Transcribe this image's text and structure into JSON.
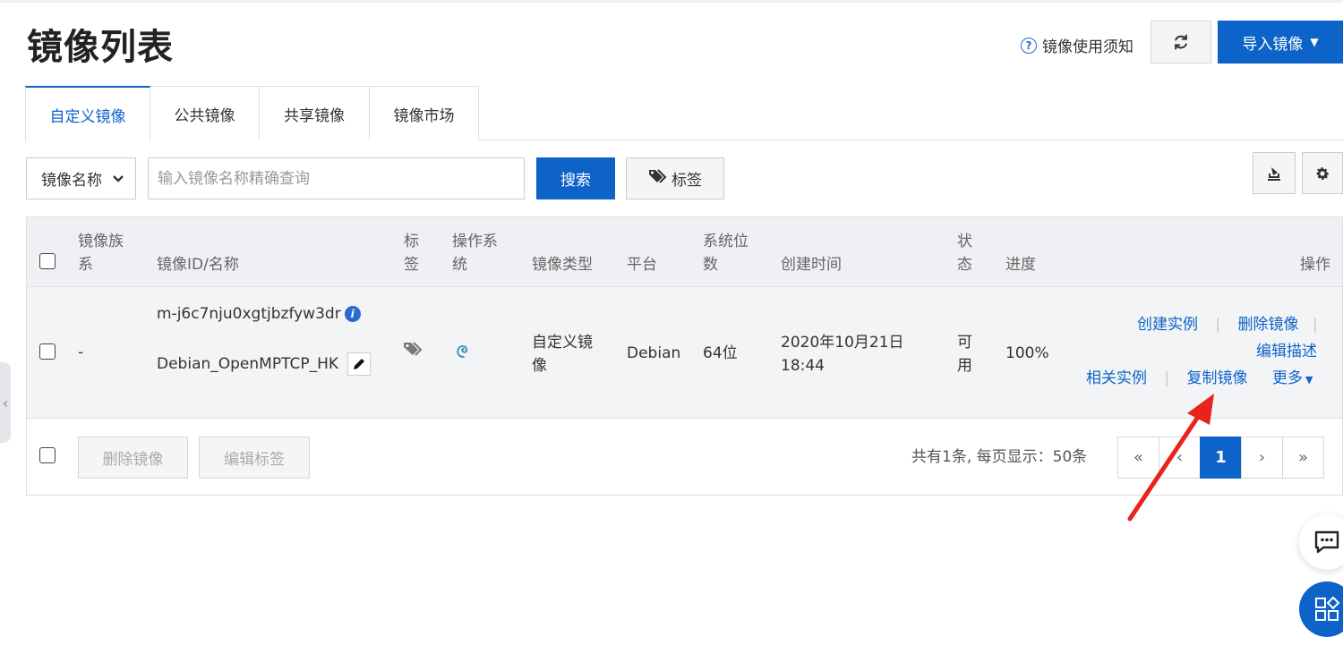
{
  "page": {
    "title": "镜像列表",
    "help_link": "镜像使用须知",
    "import_button": "导入镜像"
  },
  "tabs": [
    {
      "label": "自定义镜像",
      "active": true
    },
    {
      "label": "公共镜像",
      "active": false
    },
    {
      "label": "共享镜像",
      "active": false
    },
    {
      "label": "镜像市场",
      "active": false
    }
  ],
  "filter": {
    "select_value": "镜像名称",
    "search_placeholder": "输入镜像名称精确查询",
    "search_button": "搜索",
    "tags_button": "标签"
  },
  "table": {
    "headers": {
      "family_line1": "镜像族",
      "family_line2": "系",
      "id_name": "镜像ID/名称",
      "tag_line1": "标",
      "tag_line2": "签",
      "os_line1": "操作系",
      "os_line2": "统",
      "type": "镜像类型",
      "platform": "平台",
      "bits_line1": "系统位",
      "bits_line2": "数",
      "created": "创建时间",
      "status_line1": "状",
      "status_line2": "态",
      "progress": "进度",
      "actions": "操作"
    },
    "rows": [
      {
        "family": "-",
        "image_id": "m-j6c7nju0xgtjbzfyw3dr",
        "image_name": "Debian_OpenMPTCP_HK",
        "type_line1": "自定义镜",
        "type_line2": "像",
        "platform": "Debian",
        "bits": "64位",
        "created_line1": "2020年10月21日",
        "created_line2": "18:44",
        "status_line1": "可",
        "status_line2": "用",
        "progress": "100%",
        "actions": {
          "create_instance": "创建实例",
          "delete_image": "删除镜像",
          "edit_desc": "编辑描述",
          "related_instances": "相关实例",
          "copy_image": "复制镜像",
          "more": "更多"
        }
      }
    ]
  },
  "footer": {
    "delete_button": "删除镜像",
    "edit_tags_button": "编辑标签",
    "summary": "共有1条, 每页显示：50条",
    "pager": {
      "first": "«",
      "prev": "‹",
      "current": "1",
      "next": "›",
      "last": "»"
    }
  },
  "colors": {
    "primary": "#0d63c8",
    "arrow": "#e8231f"
  }
}
